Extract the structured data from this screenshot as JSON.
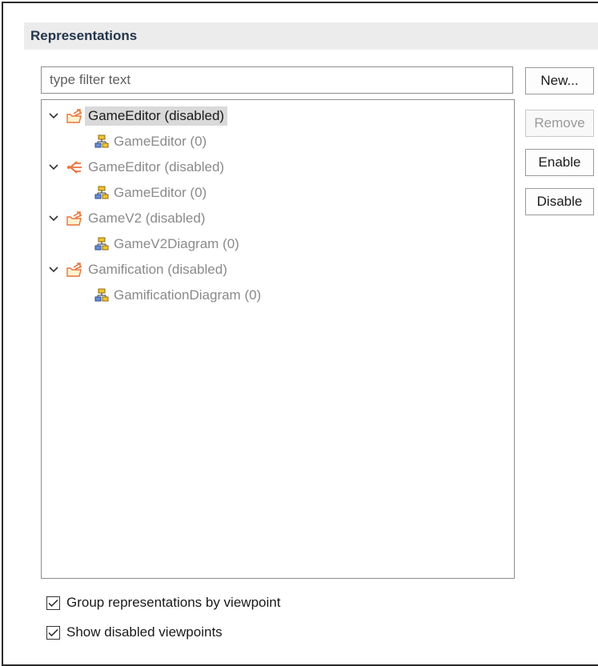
{
  "section": {
    "title": "Representations"
  },
  "filter": {
    "placeholder": "type filter text",
    "value": ""
  },
  "buttons": {
    "new": "New...",
    "remove": "Remove",
    "enable": "Enable",
    "disable": "Disable"
  },
  "tree": {
    "items": [
      {
        "label": "GameEditor (disabled)",
        "icon": "folder-viewpoint-icon",
        "selected": true,
        "child": {
          "label": "GameEditor (0)",
          "icon": "diagram-icon"
        }
      },
      {
        "label": "GameEditor (disabled)",
        "icon": "arrow-viewpoint-icon",
        "selected": false,
        "child": {
          "label": "GameEditor (0)",
          "icon": "diagram-icon"
        }
      },
      {
        "label": "GameV2 (disabled)",
        "icon": "folder-viewpoint-icon",
        "selected": false,
        "child": {
          "label": "GameV2Diagram (0)",
          "icon": "diagram-icon"
        }
      },
      {
        "label": "Gamification (disabled)",
        "icon": "folder-viewpoint-icon",
        "selected": false,
        "child": {
          "label": "GamificationDiagram (0)",
          "icon": "diagram-icon"
        }
      }
    ]
  },
  "options": {
    "group_by_viewpoint": {
      "label": "Group representations by viewpoint",
      "checked": true
    },
    "show_disabled": {
      "label": "Show disabled viewpoints",
      "checked": true
    }
  },
  "colors": {
    "accent_orange": "#e8733a",
    "header_bg": "#ececec",
    "selection_bg": "#d9d9d9"
  }
}
